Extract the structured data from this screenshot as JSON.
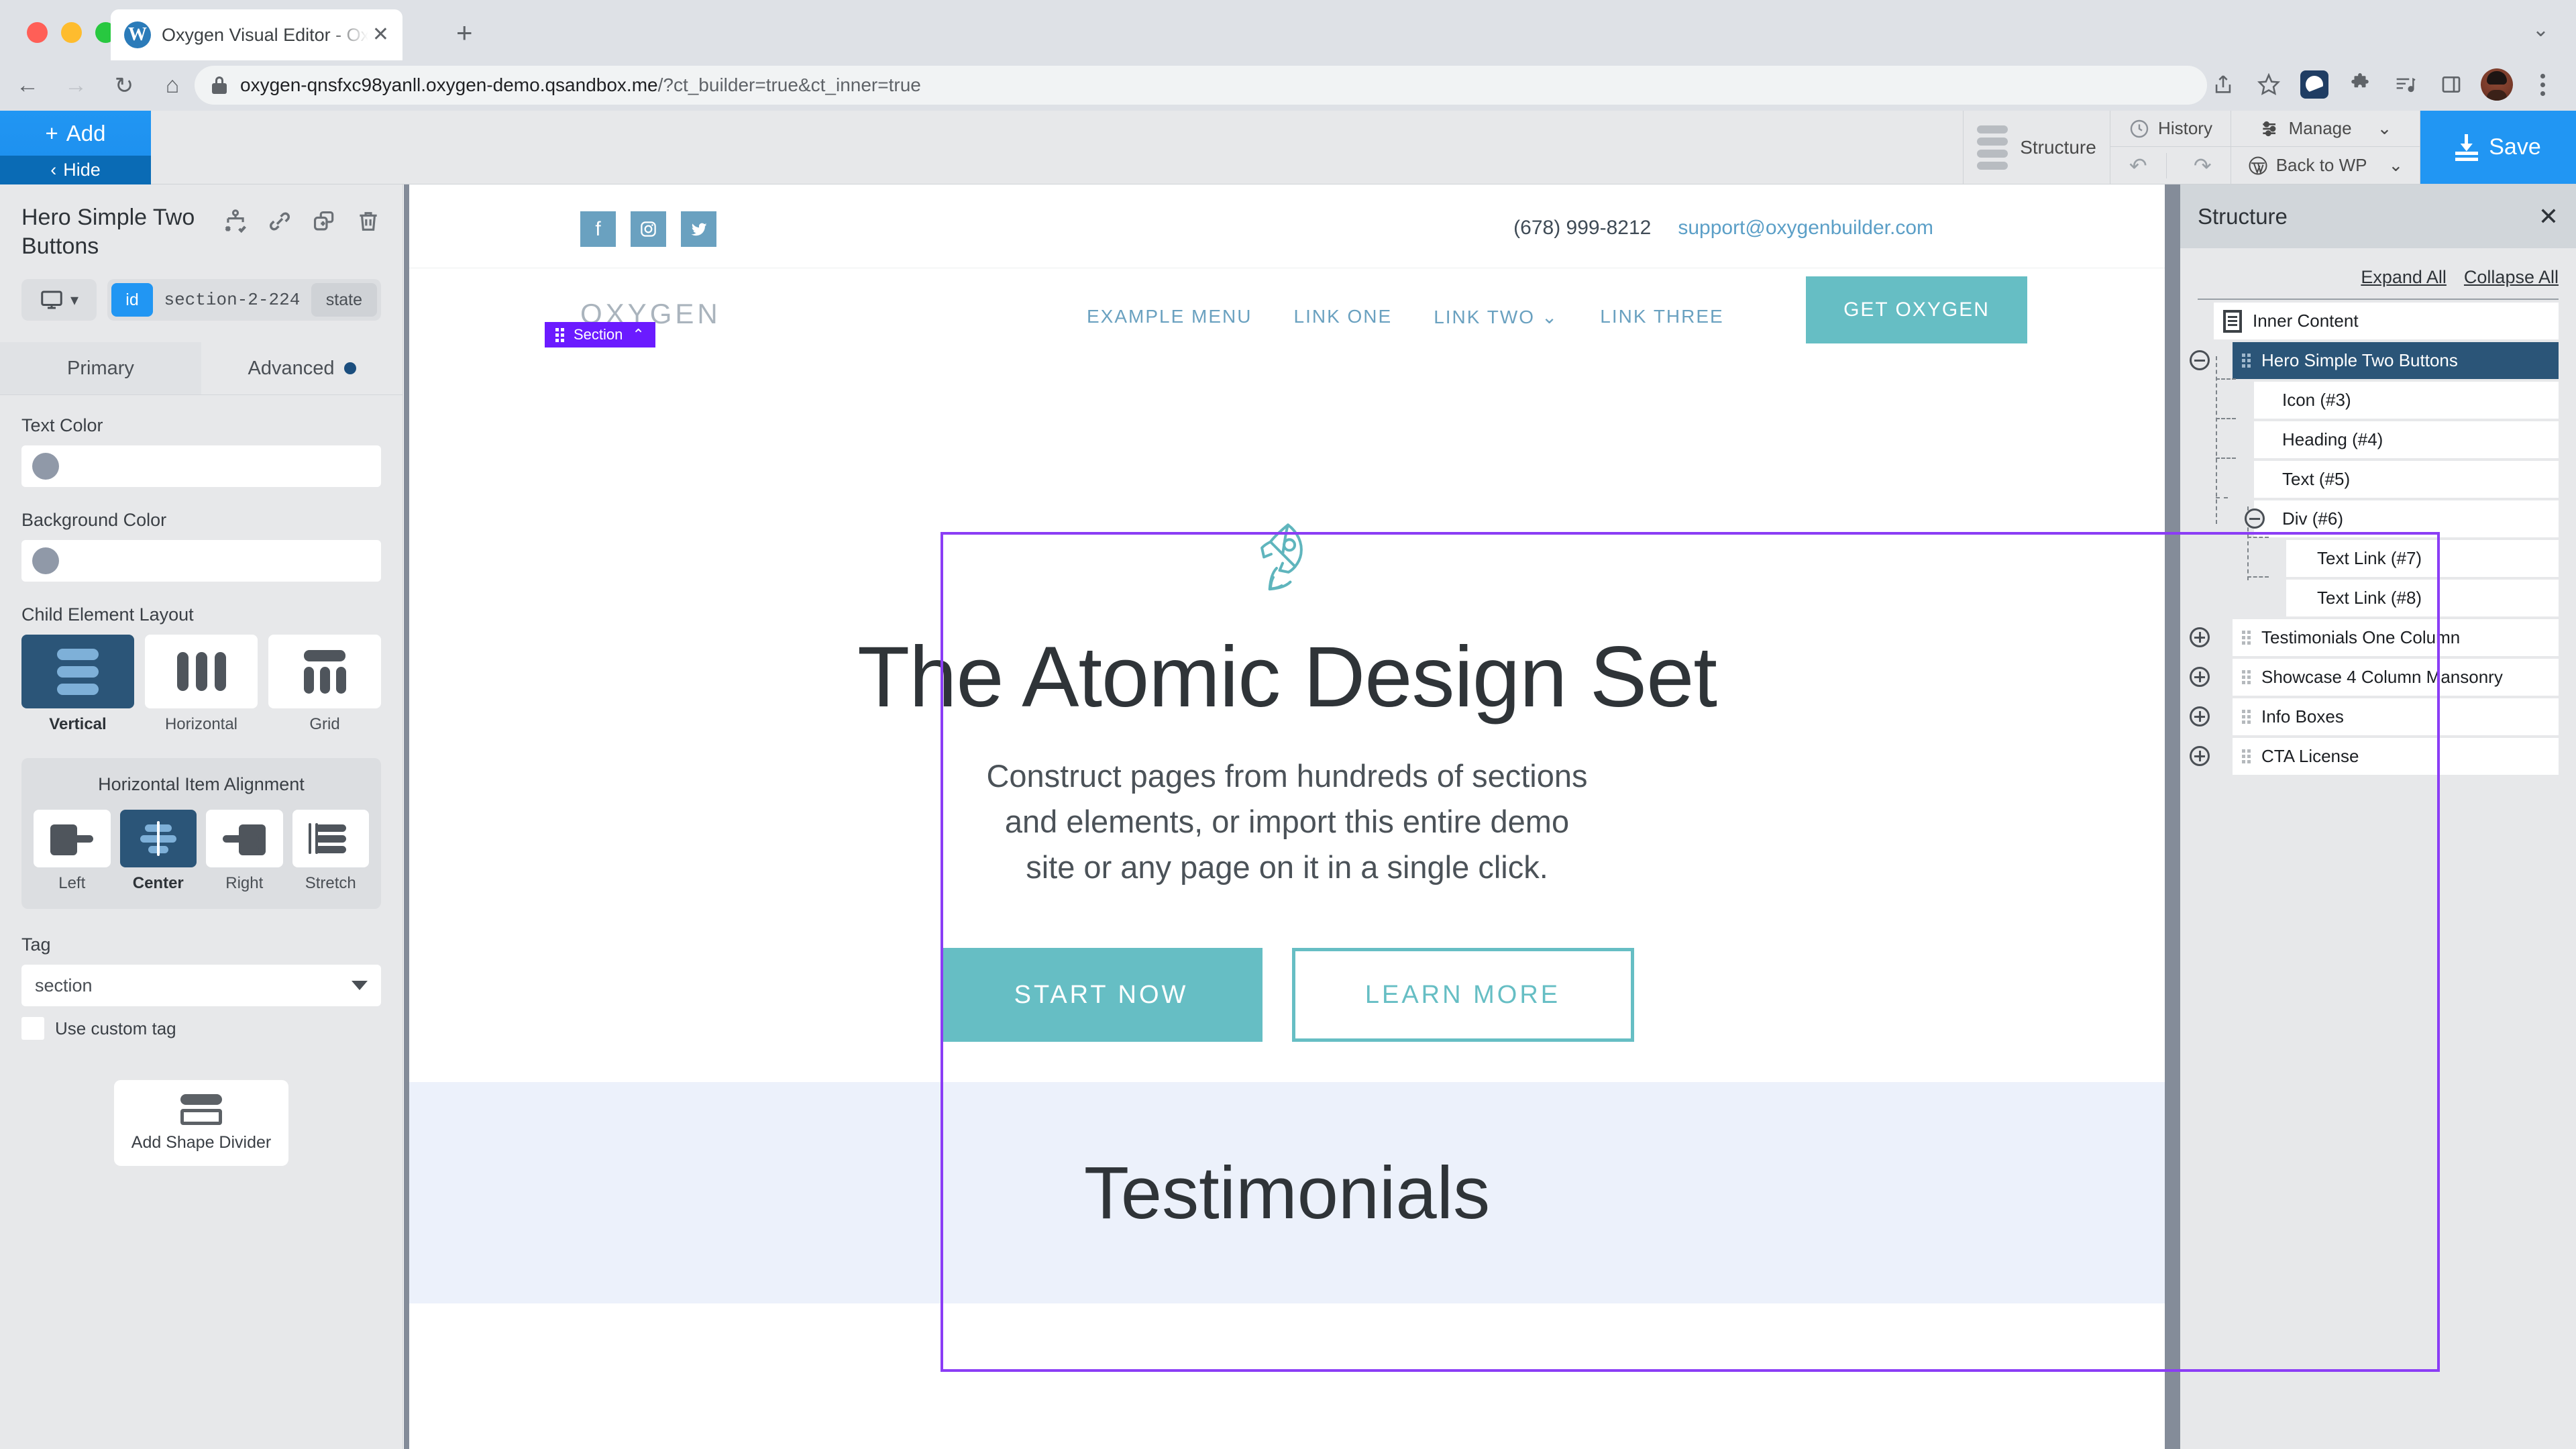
{
  "browser": {
    "tab": {
      "title": "Oxygen Visual Editor - Oxygen",
      "favicon": "wordpress-icon",
      "close": "✕"
    },
    "new_tab": "+",
    "collapse": "⌄",
    "nav": {
      "back": "←",
      "forward": "→",
      "reload": "↻",
      "home": "⌂"
    },
    "url_main": "oxygen-qnsfxc98yanll.oxygen-demo.qsandbox.me",
    "url_query": "/?ct_builder=true&ct_inner=true",
    "icons": [
      "share-icon",
      "bookmark-star-icon",
      "pocket-extension-icon",
      "puzzle-extension-icon",
      "reading-list-icon",
      "side-panel-icon",
      "profile-avatar",
      "kebab-menu-icon"
    ]
  },
  "oxygen_toolbar": {
    "add_label": "Add",
    "add_plus": "+",
    "hide_label": "Hide",
    "hide_caret": "‹",
    "structure_label": "Structure",
    "history_label": "History",
    "manage_label": "Manage",
    "back_to_wp_label": "Back to WP",
    "undo": "↶",
    "redo": "↷",
    "caret": "⌄",
    "save_label": "Save"
  },
  "left_panel": {
    "title": "Hero Simple Two Buttons",
    "actions": [
      "select-parent-icon",
      "link-icon",
      "duplicate-icon",
      "delete-icon"
    ],
    "device": "monitor-icon",
    "id_chip": "id",
    "id_value": "section-2-224",
    "state_chip": "state",
    "tabs": [
      {
        "label": "Primary",
        "active": true
      },
      {
        "label": "Advanced",
        "active": false,
        "has_dot": true
      }
    ],
    "text_color": {
      "label": "Text Color",
      "swatch": "#9099a8"
    },
    "background_color": {
      "label": "Background Color",
      "swatch": "#9099a8"
    },
    "child_element_layout": {
      "label": "Child Element Layout",
      "options": [
        {
          "label": "Vertical",
          "active": true
        },
        {
          "label": "Horizontal",
          "active": false
        },
        {
          "label": "Grid",
          "active": false
        }
      ]
    },
    "horizontal_item_alignment": {
      "label": "Horizontal Item Alignment",
      "options": [
        {
          "label": "Left",
          "active": false
        },
        {
          "label": "Center",
          "active": true
        },
        {
          "label": "Right",
          "active": false
        },
        {
          "label": "Stretch",
          "active": false
        }
      ]
    },
    "tag": {
      "label": "Tag",
      "value": "section",
      "custom_label": "Use custom tag",
      "custom_checked": false
    },
    "shape_divider": {
      "label": "Add Shape Divider"
    }
  },
  "canvas": {
    "section_badge": "Section",
    "section_badge_caret": "⌃",
    "site_topbar": {
      "socials": [
        "facebook-icon",
        "instagram-icon",
        "twitter-icon"
      ],
      "phone": "(678) 999-8212",
      "email": "support@oxygenbuilder.com"
    },
    "site_nav": {
      "logo": "OXYGEN",
      "links": [
        "EXAMPLE MENU",
        "LINK ONE",
        "LINK TWO",
        "LINK THREE"
      ],
      "link_two_caret": "⌄",
      "cta": "GET OXYGEN"
    },
    "hero": {
      "icon": "rocket-icon",
      "heading": "The Atomic Design Set",
      "paragraph_lines": [
        "Construct pages from hundreds of sections",
        "and elements, or import this entire demo",
        "site or any page on it in a single click."
      ],
      "primary_button": "START NOW",
      "secondary_button": "LEARN MORE"
    },
    "testimonials": {
      "heading": "Testimonials"
    }
  },
  "structure": {
    "title": "Structure",
    "close": "✕",
    "expand_all": "Expand All",
    "collapse_all": "Collapse All",
    "nodes": [
      {
        "label": "Inner Content",
        "level": 0,
        "selected": false,
        "icon": "document-icon",
        "toggle": "none"
      },
      {
        "label": "Hero Simple Two Buttons",
        "level": 1,
        "selected": true,
        "toggle": "minus"
      },
      {
        "label": "Icon (#3)",
        "level": 2,
        "selected": false,
        "toggle": "none"
      },
      {
        "label": "Heading (#4)",
        "level": 2,
        "selected": false,
        "toggle": "none"
      },
      {
        "label": "Text (#5)",
        "level": 2,
        "selected": false,
        "toggle": "none"
      },
      {
        "label": "Div (#6)",
        "level": 2,
        "selected": false,
        "toggle": "minus"
      },
      {
        "label": "Text Link (#7)",
        "level": 3,
        "selected": false,
        "toggle": "none"
      },
      {
        "label": "Text Link (#8)",
        "level": 3,
        "selected": false,
        "toggle": "none"
      },
      {
        "label": "Testimonials One Column",
        "level": 1,
        "selected": false,
        "toggle": "plus"
      },
      {
        "label": "Showcase 4 Column Mansonry",
        "level": 1,
        "selected": false,
        "toggle": "plus"
      },
      {
        "label": "Info Boxes",
        "level": 1,
        "selected": false,
        "toggle": "plus"
      },
      {
        "label": "CTA License",
        "level": 1,
        "selected": false,
        "toggle": "plus"
      }
    ]
  },
  "colors": {
    "accent_blue": "#2196f3",
    "teal": "#66bec4",
    "purple_outline": "#8b3df5",
    "tree_selected": "#2b5578",
    "panel_bg": "#e7e8ea"
  }
}
